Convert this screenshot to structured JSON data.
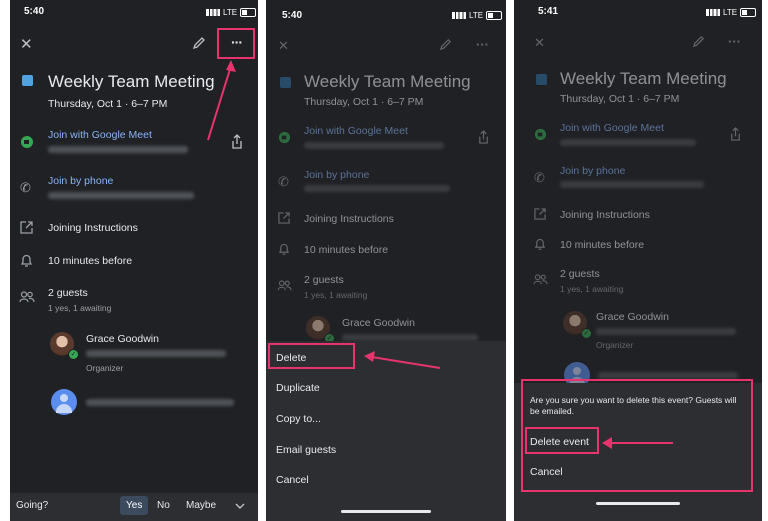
{
  "screens": [
    {
      "status_time": "5:40",
      "network": "LTE",
      "event_title": "Weekly Team Meeting",
      "event_time": "Thursday, Oct 1 · 6–7 PM",
      "meet_label": "Join with Google Meet",
      "phone_label": "Join by phone",
      "instructions_label": "Joining Instructions",
      "reminder": "10 minutes before",
      "guests_count": "2 guests",
      "guests_status": "1 yes, 1 awaiting",
      "organizer_name": "Grace Goodwin",
      "organizer_role": "Organizer",
      "going_label": "Going?",
      "rsvp_yes": "Yes",
      "rsvp_no": "No",
      "rsvp_maybe": "Maybe"
    },
    {
      "status_time": "5:40",
      "network": "LTE",
      "event_title": "Weekly Team Meeting",
      "event_time": "Thursday, Oct 1 · 6–7 PM",
      "meet_label": "Join with Google Meet",
      "phone_label": "Join by phone",
      "instructions_label": "Joining Instructions",
      "reminder": "10 minutes before",
      "guests_count": "2 guests",
      "guests_status": "1 yes, 1 awaiting",
      "organizer_name": "Grace Goodwin",
      "menu": [
        "Delete",
        "Duplicate",
        "Copy to...",
        "Email guests",
        "Cancel"
      ]
    },
    {
      "status_time": "5:41",
      "network": "LTE",
      "event_title": "Weekly Team Meeting",
      "event_time": "Thursday, Oct 1 · 6–7 PM",
      "meet_label": "Join with Google Meet",
      "phone_label": "Join by phone",
      "instructions_label": "Joining Instructions",
      "reminder": "10 minutes before",
      "guests_count": "2 guests",
      "guests_status": "1 yes, 1 awaiting",
      "organizer_name": "Grace Goodwin",
      "organizer_role": "Organizer",
      "confirm_text": "Are you sure you want to delete this event? Guests will be emailed.",
      "delete_event_label": "Delete event",
      "cancel_label": "Cancel"
    }
  ],
  "colors": {
    "highlight": "#e8336d",
    "link": "#8ab4f8",
    "background": "#202124",
    "calendar": "#4fa3e0"
  },
  "icons": [
    "close-icon",
    "edit-icon",
    "more-icon",
    "share-icon",
    "meet-icon",
    "phone-icon",
    "open-link-icon",
    "bell-icon",
    "people-icon",
    "chevron-down-icon"
  ]
}
